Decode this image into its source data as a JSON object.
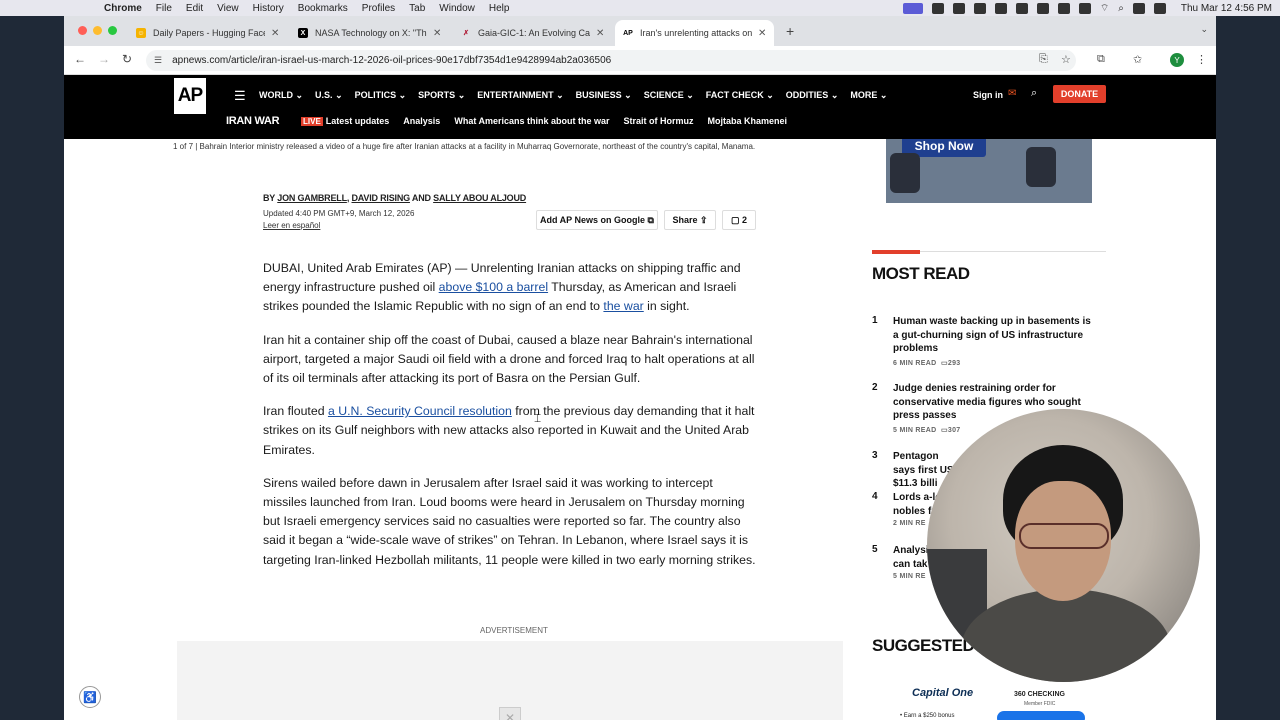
{
  "menubar": {
    "app": "Chrome",
    "items": [
      "File",
      "Edit",
      "View",
      "History",
      "Bookmarks",
      "Profiles",
      "Tab",
      "Window",
      "Help"
    ],
    "clock": "Thu Mar 12  4:56 PM"
  },
  "tabs": [
    {
      "title": "Daily Papers - Hugging Face",
      "favicon": "hugging-face-icon",
      "color": "#f5b301"
    },
    {
      "title": "NASA Technology on X: \"The",
      "favicon": "x-icon",
      "color": "#000000"
    },
    {
      "title": "Gaia-GIC-1: An Evolving Cata",
      "favicon": "gaia-icon",
      "color": "#b0203a"
    },
    {
      "title": "Iran's unrelenting attacks on s",
      "favicon": "ap-icon",
      "color": "#000000"
    }
  ],
  "address": {
    "url": "apnews.com/article/iran-israel-us-march-12-2026-oil-prices-90e17dbf7354d1e9428994ab2a036506",
    "profile_initial": "Y"
  },
  "apnav": {
    "logo": "AP",
    "main": [
      "WORLD",
      "U.S.",
      "POLITICS",
      "SPORTS",
      "ENTERTAINMENT",
      "BUSINESS",
      "SCIENCE",
      "FACT CHECK",
      "ODDITIES",
      "MORE"
    ],
    "signin": "Sign in",
    "donate": "DONATE",
    "section": "IRAN WAR",
    "live": "LIVE",
    "sub": [
      "Latest updates",
      "Analysis",
      "What Americans think about the war",
      "Strait of Hormuz",
      "Mojtaba Khamenei"
    ]
  },
  "article": {
    "caption": "1 of 7 |  Bahrain Interior ministry released a video of a huge fire after Iranian attacks at a facility in Muharraq Governorate, northeast of the country's capital, Manama.",
    "by": "BY",
    "author1": "JON GAMBRELL",
    "sep1": ",",
    "author2": "DAVID RISING",
    "and": "AND",
    "author3": "SALLY ABOU ALJOUD",
    "updated": "Updated 4:40 PM GMT+9, March 12, 2026",
    "leer": "Leer en español",
    "add_google": "Add AP News on Google",
    "share": "Share",
    "comments": "2",
    "p1a": "DUBAI, United Arab Emirates (AP) — Unrelenting Iranian attacks on shipping traffic and energy infrastructure pushed oil ",
    "p1link1": "above $100 a barrel",
    "p1b": " Thursday, as American and Israeli strikes pounded the Islamic Republic with no sign of an end to ",
    "p1link2": "the war",
    "p1c": " in sight.",
    "p2": "Iran hit a container ship off the coast of Dubai, caused a blaze near Bahrain's international airport, targeted a major Saudi oil field with a drone and forced Iraq to halt operations at all of its oil terminals after attacking its port of Basra on the Persian Gulf.",
    "p3a": "Iran flouted ",
    "p3link": "a U.N. Security Council resolution",
    "p3b": " from the previous day demanding that it halt strikes on its Gulf neighbors with new attacks also reported in Kuwait and the United Arab Emirates.",
    "p4": "Sirens wailed before dawn in Jerusalem after Israel said it was working to intercept missiles launched from Iran. Loud booms were heard in Jerusalem on Thursday morning but Israeli emergency services said no casualties were reported so far. The country also said it began a “wide-scale wave of strikes” on Tehran. In Lebanon, where Israel says it is targeting Iran-linked Hezbollah militants, 11 people were killed in two early morning strikes.",
    "advertisement": "ADVERTISEMENT"
  },
  "sidebar": {
    "shop_now": "Shop Now",
    "most_read": "MOST READ",
    "items": [
      {
        "num": "1",
        "title": "Human waste backing up in basements is a gut-churning sign of US infrastructure problems",
        "read": "6 MIN READ",
        "comments": "293"
      },
      {
        "num": "2",
        "title": "Judge denies restraining order for conservative media figures who sought press passes",
        "read": "5 MIN READ",
        "comments": "307"
      },
      {
        "num": "3",
        "title": "Pentagon says first US $11.3 billi",
        "read": "",
        "comments": ""
      },
      {
        "num": "4",
        "title": "Lords a-le nobles fr",
        "read": "2 MIN RE",
        "comments": ""
      },
      {
        "num": "5",
        "title": "Analysi can tak",
        "read": "5 MIN RE",
        "comments": ""
      }
    ],
    "suggested": "SUGGESTED",
    "capital_one": "Capital One",
    "capital_one_sub": "• Earn a $250 bonus",
    "checking": "360 CHECKING",
    "fdic": "Member FDIC"
  }
}
